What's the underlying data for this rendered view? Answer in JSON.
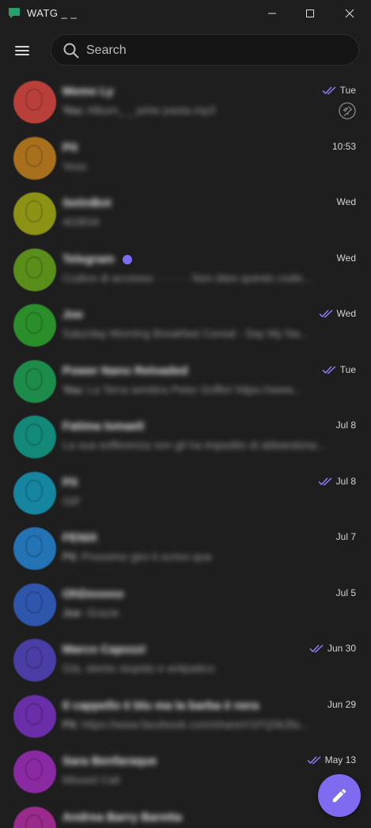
{
  "window": {
    "title": "WATG _ _"
  },
  "search": {
    "placeholder": "Search"
  },
  "colors": {
    "accent": "#7f6bf0",
    "background": "#1e1e1e"
  },
  "chats": [
    {
      "name": "Memo Ly",
      "time": "Tue",
      "ticks": true,
      "pinned": true,
      "sender": "You:",
      "preview": " Album_ _ pinto pasta.mp3",
      "avatar_color": "#b9403a"
    },
    {
      "name": "Pit",
      "time": "10:53",
      "ticks": false,
      "pinned": false,
      "sender": "",
      "preview": "Yeso",
      "avatar_color": "#a8701d"
    },
    {
      "name": "SetinBot",
      "time": "Wed",
      "ticks": false,
      "pinned": false,
      "sender": "",
      "preview": "403634",
      "avatar_color": "#8c9314"
    },
    {
      "name": "Telegram",
      "time": "Wed",
      "ticks": false,
      "pinned": false,
      "verified": true,
      "sender": "",
      "preview": "Codice di accesso: · · · · · Non dare questo codic...",
      "avatar_color": "#5a8e1a"
    },
    {
      "name": "Joe",
      "time": "Wed",
      "ticks": true,
      "pinned": false,
      "sender": "",
      "preview": "Saturday Morning Breakfast Cereal - Say My Na...",
      "avatar_color": "#2a8f2a"
    },
    {
      "name": "Power Nano Reloaded",
      "time": "Tue",
      "ticks": true,
      "pinned": false,
      "sender": "You:",
      "preview": " La Terra sembra Peter Griffin! https://www...",
      "avatar_color": "#1d8c4a"
    },
    {
      "name": "Fatima Ismaeli",
      "time": "Jul 8",
      "ticks": false,
      "pinned": false,
      "sender": "",
      "preview": "La sua sofferenza non gli ha impedito di abbandona...",
      "avatar_color": "#13897a"
    },
    {
      "name": "Pit",
      "time": "Jul 8",
      "ticks": true,
      "pinned": false,
      "sender": "",
      "preview": "GIF",
      "avatar_color": "#1685a0"
    },
    {
      "name": "FENIX",
      "time": "Jul 7",
      "ticks": false,
      "pinned": false,
      "sender": "Pit:",
      "preview": " Prossimo giro ti scrivo qua",
      "avatar_color": "#2373b5"
    },
    {
      "name": "OhDooooo",
      "time": "Jul 5",
      "ticks": false,
      "pinned": false,
      "sender": "Joe:",
      "preview": " Grazie",
      "avatar_color": "#2f56ad"
    },
    {
      "name": "Marco Capozzi",
      "time": "Jun 30",
      "ticks": true,
      "pinned": false,
      "sender": "",
      "preview": "Già, stento stupido e antipatico",
      "avatar_color": "#4a3ea6"
    },
    {
      "name": "Il cappello è blu ma la barba è nera",
      "time": "Jun 29",
      "ticks": false,
      "pinned": false,
      "sender": "Pit:",
      "preview": " https://www.facebook.com/share/r/1FQ5k3fa...",
      "avatar_color": "#6a2ea8"
    },
    {
      "name": "Sara Benfaraque",
      "time": "May 13",
      "ticks": true,
      "pinned": false,
      "sender": "",
      "preview": "Missed Call",
      "avatar_color": "#8a2aa3"
    },
    {
      "name": "Andrea Barry Baretta",
      "time": "",
      "ticks": false,
      "pinned": false,
      "sender": "",
      "preview": "",
      "avatar_color": "#9a2a8c"
    }
  ]
}
